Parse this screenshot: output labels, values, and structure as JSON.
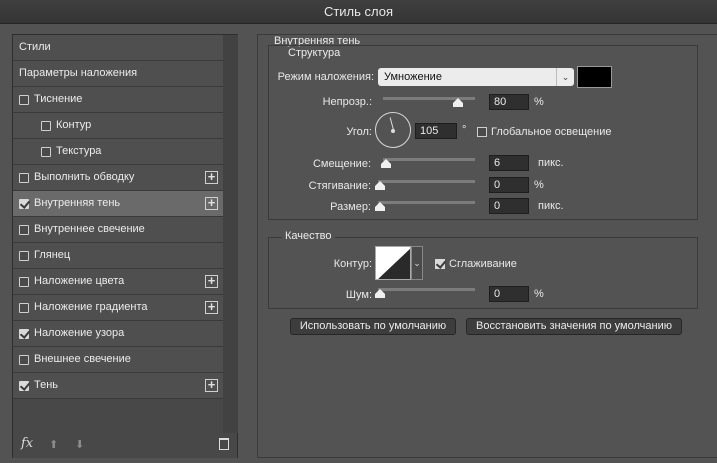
{
  "window": {
    "title": "Стиль слоя"
  },
  "left": {
    "items": [
      {
        "label": "Стили",
        "kind": "header"
      },
      {
        "label": "Параметры наложения",
        "kind": "plain"
      },
      {
        "label": "Тиснение",
        "checked": false,
        "plus": false,
        "indent": false
      },
      {
        "label": "Контур",
        "checked": false,
        "plus": false,
        "indent": true
      },
      {
        "label": "Текстура",
        "checked": false,
        "plus": false,
        "indent": true
      },
      {
        "label": "Выполнить обводку",
        "checked": false,
        "plus": true,
        "indent": false
      },
      {
        "label": "Внутренняя тень",
        "checked": true,
        "plus": true,
        "indent": false,
        "selected": true
      },
      {
        "label": "Внутреннее свечение",
        "checked": false,
        "plus": false,
        "indent": false
      },
      {
        "label": "Глянец",
        "checked": false,
        "plus": false,
        "indent": false
      },
      {
        "label": "Наложение цвета",
        "checked": false,
        "plus": true,
        "indent": false
      },
      {
        "label": "Наложение градиента",
        "checked": false,
        "plus": true,
        "indent": false
      },
      {
        "label": "Наложение узора",
        "checked": true,
        "plus": false,
        "indent": false
      },
      {
        "label": "Внешнее свечение",
        "checked": false,
        "plus": false,
        "indent": false
      },
      {
        "label": "Тень",
        "checked": true,
        "plus": true,
        "indent": false
      }
    ],
    "footer": {
      "fx": "fx",
      "up_icon": "arrow-up-icon",
      "down_icon": "arrow-down-icon",
      "trash_icon": "trash-icon"
    }
  },
  "panel": {
    "title": "Внутренняя тень",
    "structure": {
      "title": "Структура",
      "blend_mode_label": "Режим наложения:",
      "blend_mode_value": "Умножение",
      "shadow_color": "#000000",
      "opacity_label": "Непрозр.:",
      "opacity_value": "80",
      "opacity_unit": "%",
      "angle_label": "Угол:",
      "angle_value": "105",
      "angle_unit": "°",
      "global_light_label": "Глобальное освещение",
      "global_light_checked": false,
      "distance_label": "Смещение:",
      "distance_value": "6",
      "distance_unit": "пикс.",
      "choke_label": "Стягивание:",
      "choke_value": "0",
      "choke_unit": "%",
      "size_label": "Размер:",
      "size_value": "0",
      "size_unit": "пикс."
    },
    "quality": {
      "title": "Качество",
      "contour_label": "Контур:",
      "antialias_label": "Сглаживание",
      "antialias_checked": true,
      "noise_label": "Шум:",
      "noise_value": "0",
      "noise_unit": "%"
    },
    "buttons": {
      "default": "Использовать по умолчанию",
      "reset": "Восстановить значения по умолчанию"
    }
  }
}
